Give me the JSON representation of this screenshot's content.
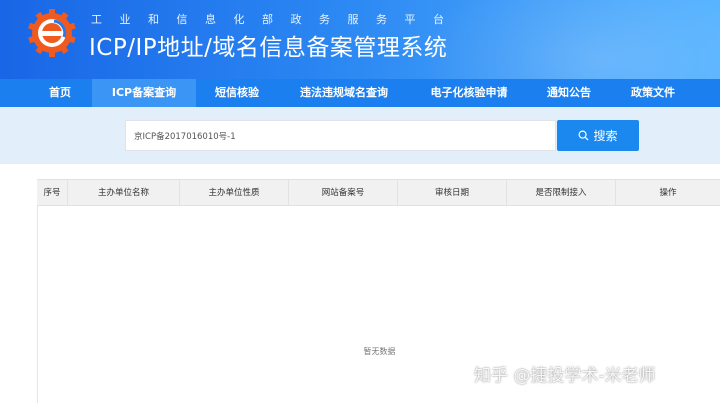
{
  "header": {
    "subtitle": "工业和信息化部政务服务平台",
    "title": "ICP/IP地址/域名信息备案管理系统"
  },
  "nav": {
    "items": [
      {
        "label": "首页"
      },
      {
        "label": "ICP备案查询",
        "active": true
      },
      {
        "label": "短信核验"
      },
      {
        "label": "违法违规域名查询"
      },
      {
        "label": "电子化核验申请"
      },
      {
        "label": "通知公告"
      },
      {
        "label": "政策文件"
      }
    ]
  },
  "search": {
    "value": "京ICP备2017016010号-1",
    "button_label": "搜索"
  },
  "table": {
    "columns": [
      "序号",
      "主办单位名称",
      "主办单位性质",
      "网站备案号",
      "审核日期",
      "是否限制接入",
      "操作"
    ],
    "empty_text": "暂无数据"
  },
  "watermark": "知乎 @捷投学术-米老师",
  "colors": {
    "nav_bg": "#1b7ff0",
    "nav_active": "#3b95f4",
    "button": "#1a88ee",
    "search_band": "#e3eefb"
  },
  "icons": {
    "logo": "emblem-gear-logo",
    "search": "search-icon"
  }
}
